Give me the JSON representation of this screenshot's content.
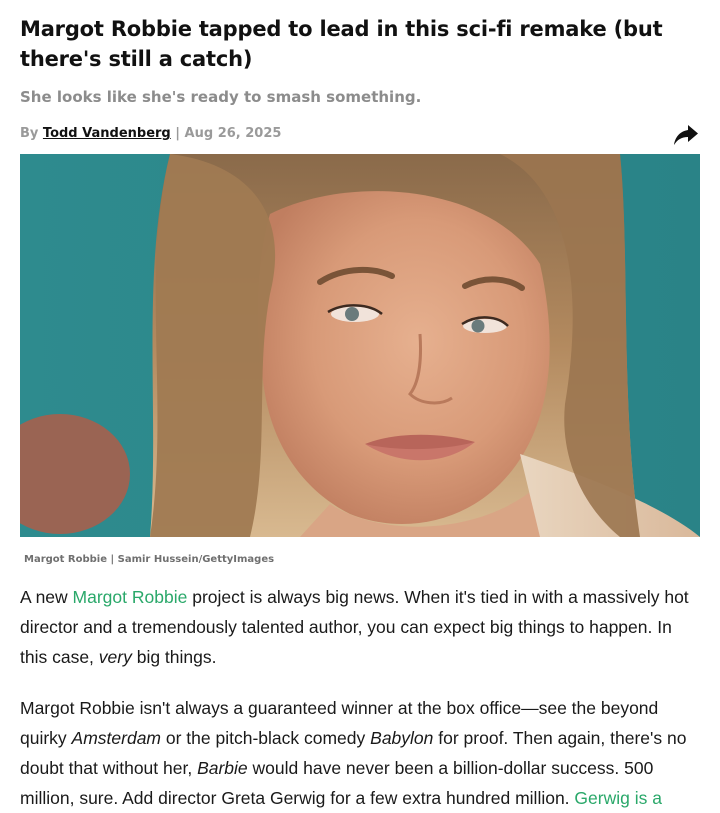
{
  "article": {
    "headline": "Margot Robbie tapped to lead in this sci-fi remake (but there's still a catch)",
    "subhead": "She looks like she's ready to smash something.",
    "byline": {
      "prefix": "By",
      "author": "Todd Vandenberg",
      "separator": "|",
      "date": "Aug 26, 2025"
    },
    "share_icon": "share-arrow-icon",
    "image": {
      "caption": "Margot Robbie | Samir Hussein/GettyImages"
    },
    "paragraph1": {
      "t1": "A new ",
      "link": "Margot Robbie",
      "t2": " project is always big news. When it's tied in with a massively hot director and a tremendously talented author, you can expect big things to happen. In this case, ",
      "em": "very",
      "t3": " big things."
    },
    "paragraph2": {
      "t1": "Margot Robbie isn't always a guaranteed winner at the box office—see the beyond quirky ",
      "em1": "Amsterdam",
      "t2": " or the pitch-black comedy ",
      "em2": "Babylon",
      "t3": " for proof. Then again, there's no doubt that without her, ",
      "em3": "Barbie",
      "t4": " would have never been a billion-dollar success. 500 million, sure. Add director Greta Gerwig for a few extra hundred million. ",
      "link": "Gerwig is a"
    },
    "colors": {
      "link": "#2aa86a",
      "subhead": "#8c8c8c",
      "background": "#ffffff"
    }
  }
}
